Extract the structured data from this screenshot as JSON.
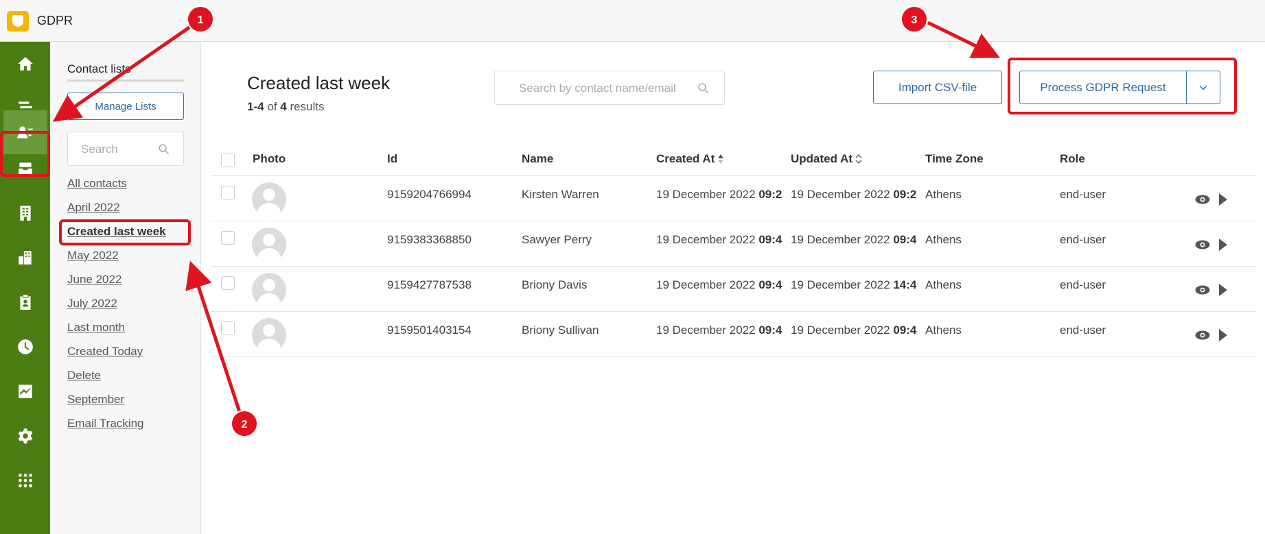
{
  "app": {
    "title": "GDPR"
  },
  "rail": {
    "icons": [
      "home-icon",
      "stacks-icon",
      "contacts-icon",
      "inbox-icon",
      "building-icon",
      "organization-icon",
      "badge-icon",
      "clock-icon",
      "chart-icon",
      "gear-icon",
      "apps-grid-icon"
    ],
    "active": "contacts-icon",
    "color": "#4b7d12"
  },
  "panel": {
    "title": "Contact lists",
    "manage_label": "Manage Lists",
    "search_placeholder": "Search",
    "lists": [
      "All contacts",
      "April 2022",
      "Created last week",
      "May 2022",
      "June 2022",
      "July 2022",
      "Last month",
      "Created Today",
      "Delete",
      "September",
      "Email Tracking"
    ],
    "current": "Created last week"
  },
  "main": {
    "title": "Created last week",
    "range": "1-4",
    "of": "of",
    "total": "4",
    "results_word": "results",
    "search_placeholder": "Search by contact name/email",
    "import_label": "Import CSV-file",
    "gdpr_label": "Process GDPR Request"
  },
  "table": {
    "headers": {
      "photo": "Photo",
      "id": "Id",
      "name": "Name",
      "created": "Created At",
      "updated": "Updated At",
      "timezone": "Time Zone",
      "role": "Role"
    },
    "rows": [
      {
        "id": "9159204766994",
        "name": "Kirsten Warren",
        "created_date": "19 December 2022",
        "created_time": "09:2",
        "updated_date": "19 December 2022",
        "updated_time": "09:2",
        "timezone": "Athens",
        "role": "end-user"
      },
      {
        "id": "9159383368850",
        "name": "Sawyer Perry",
        "created_date": "19 December 2022",
        "created_time": "09:4",
        "updated_date": "19 December 2022",
        "updated_time": "09:4",
        "timezone": "Athens",
        "role": "end-user"
      },
      {
        "id": "9159427787538",
        "name": "Briony Davis",
        "created_date": "19 December 2022",
        "created_time": "09:4",
        "updated_date": "19 December 2022",
        "updated_time": "14:4",
        "timezone": "Athens",
        "role": "end-user"
      },
      {
        "id": "9159501403154",
        "name": "Briony Sullivan",
        "created_date": "19 December 2022",
        "created_time": "09:4",
        "updated_date": "19 December 2022",
        "updated_time": "09:4",
        "timezone": "Athens",
        "role": "end-user"
      }
    ]
  },
  "annotations": {
    "badges": [
      "1",
      "2",
      "3"
    ],
    "color": "#e0141e"
  }
}
